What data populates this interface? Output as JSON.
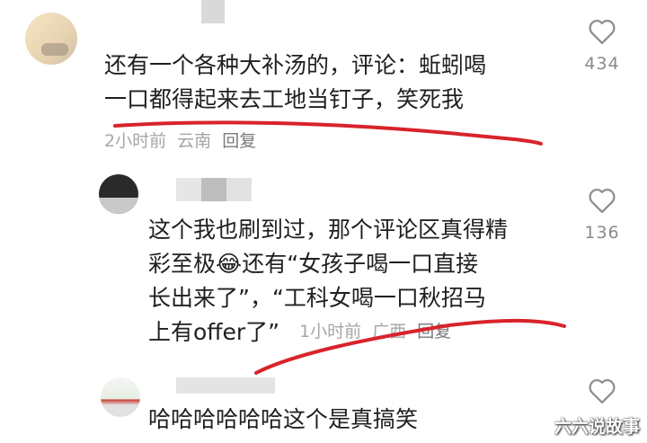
{
  "comments": [
    {
      "lines": [
        "还有一个各种大补汤的，评论：蚯蚓喝",
        "一口都得起来去工地当钉子，笑死我"
      ],
      "time": "2小时前",
      "location": "云南",
      "reply_label": "回复",
      "likes": "434"
    },
    {
      "lines": [
        "这个我也刷到过，那个评论区真得精",
        "彩至极😂还有“女孩子喝一口直接",
        "长出来了”，“工科女喝一口秋招马",
        "上有offer了”"
      ],
      "time": "1小时前",
      "location": "广西",
      "reply_label": "回复",
      "likes": "136"
    },
    {
      "lines": [
        "哈哈哈哈哈哈这个是真搞笑"
      ],
      "likes": ""
    }
  ],
  "watermark": "六六说故事",
  "colors": {
    "annotation": "#d8232a",
    "heart": "#8f8f8f"
  },
  "icons": {
    "like": "heart-outline-icon"
  }
}
